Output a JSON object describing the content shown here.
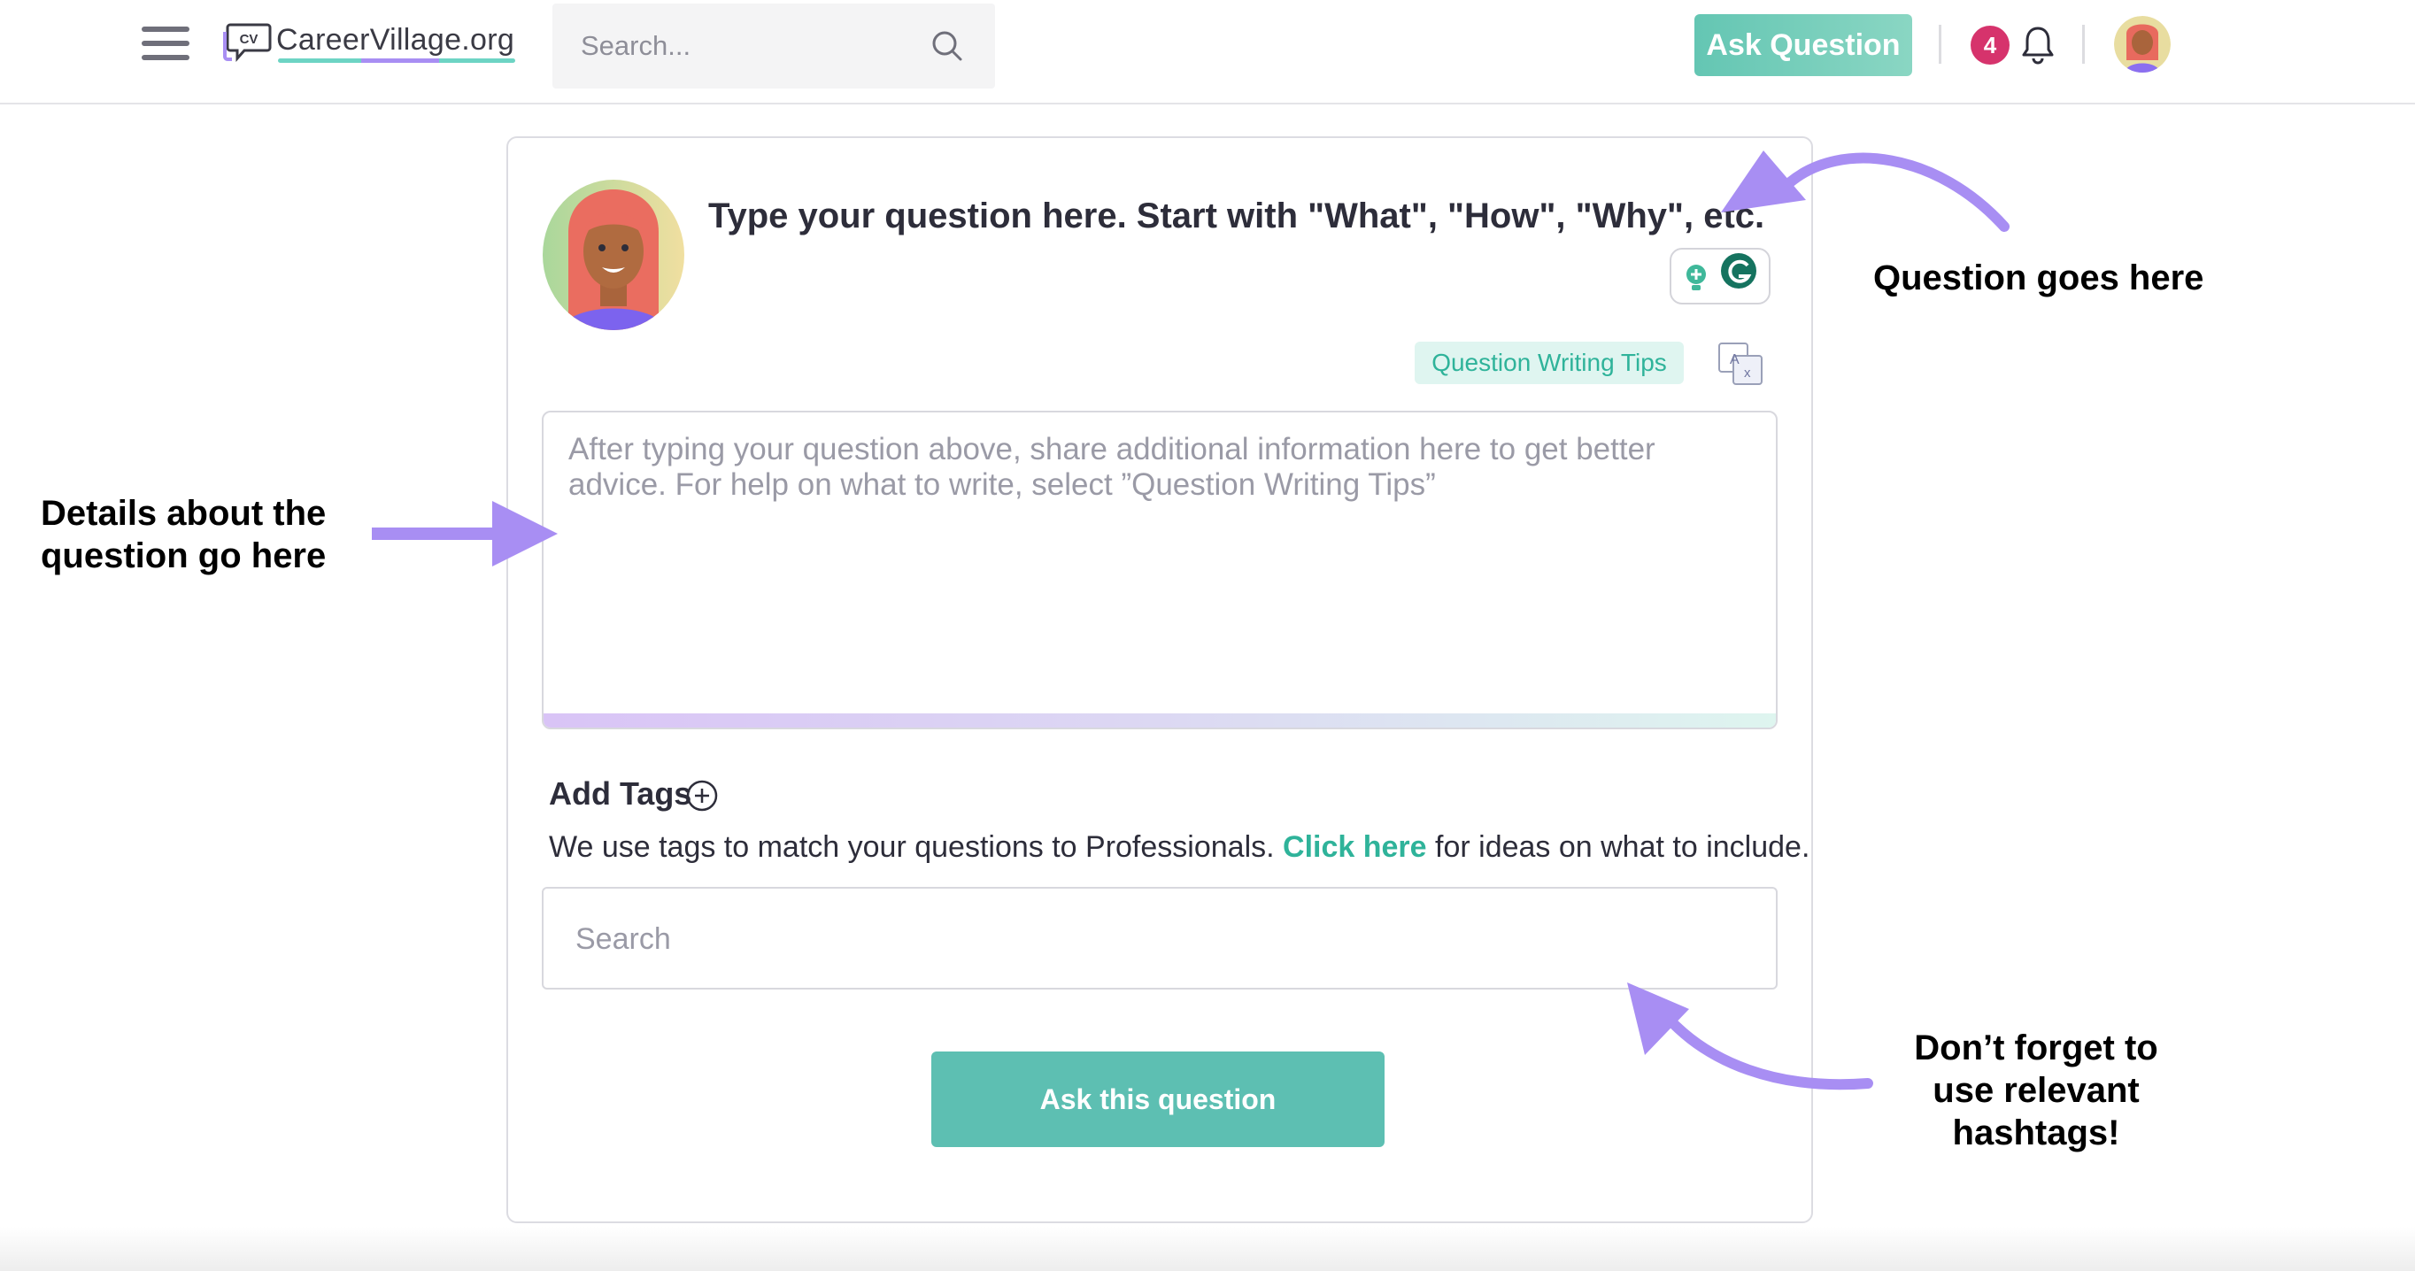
{
  "header": {
    "logo_badge": "CV",
    "logo_text": "CareerVillage.org",
    "search_placeholder": "Search...",
    "ask_button": "Ask Question",
    "notification_count": "4"
  },
  "form": {
    "question_prompt": "Type your question here. Start with \"What\", \"How\", \"Why\", etc.",
    "tips_button": "Question Writing Tips",
    "details_placeholder": "After typing your question above, share additional information here to get better advice. For help on what to write, select ”Question Writing Tips”",
    "add_tags_label": "Add Tags",
    "tags_help_prefix": "We use tags to match your questions to Professionals.",
    "tags_help_link": "Click here",
    "tags_help_suffix": "for ideas on what to include.",
    "tag_search_placeholder": "Search",
    "submit_button": "Ask this question"
  },
  "annotations": {
    "question_note": "Question goes here",
    "details_note_line1": "Details about the",
    "details_note_line2": "question go here",
    "tags_note_line1": "Don’t forget to",
    "tags_note_line2": "use relevant",
    "tags_note_line3": "hashtags!"
  },
  "colors": {
    "accent_teal": "#5dbfb2",
    "arrow_purple": "#a88ef3",
    "badge_red": "#d6336c"
  },
  "icons": [
    "menu-icon",
    "logo-icon",
    "search-icon",
    "bell-icon",
    "lightbulb-icon",
    "grammarly-icon",
    "translate-icon",
    "plus-circle-icon"
  ]
}
